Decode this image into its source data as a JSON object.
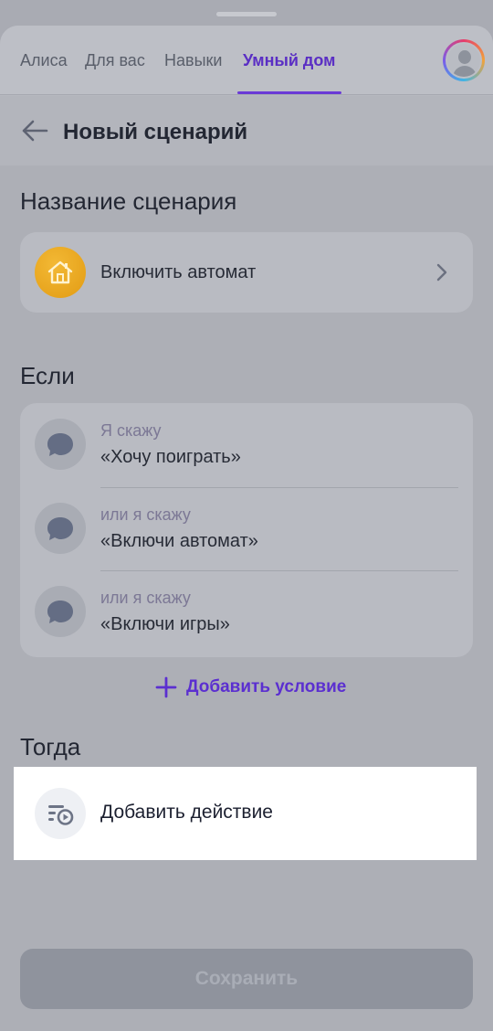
{
  "tabs": [
    {
      "label": "Алиса",
      "active": false
    },
    {
      "label": "Для вас",
      "active": false
    },
    {
      "label": "Навыки",
      "active": false
    },
    {
      "label": "Умный дом",
      "active": true
    }
  ],
  "header": {
    "title": "Новый сценарий",
    "back_icon": "arrow-left-icon"
  },
  "name_section": {
    "title": "Название сценария",
    "scenario_name": "Включить автомат",
    "icon": "home-icon"
  },
  "if_section": {
    "title": "Если",
    "conditions": [
      {
        "label": "Я скажу",
        "phrase": "«Хочу поиграть»"
      },
      {
        "label": "или я скажу",
        "phrase": "«Включи автомат»"
      },
      {
        "label": "или я скажу",
        "phrase": "«Включи игры»"
      }
    ],
    "add_condition_label": "Добавить условие"
  },
  "then_section": {
    "title": "Тогда",
    "add_action_label": "Добавить действие"
  },
  "save_label": "Сохранить",
  "colors": {
    "accent": "#5b2fd0",
    "home_icon": "#f0b42a"
  }
}
